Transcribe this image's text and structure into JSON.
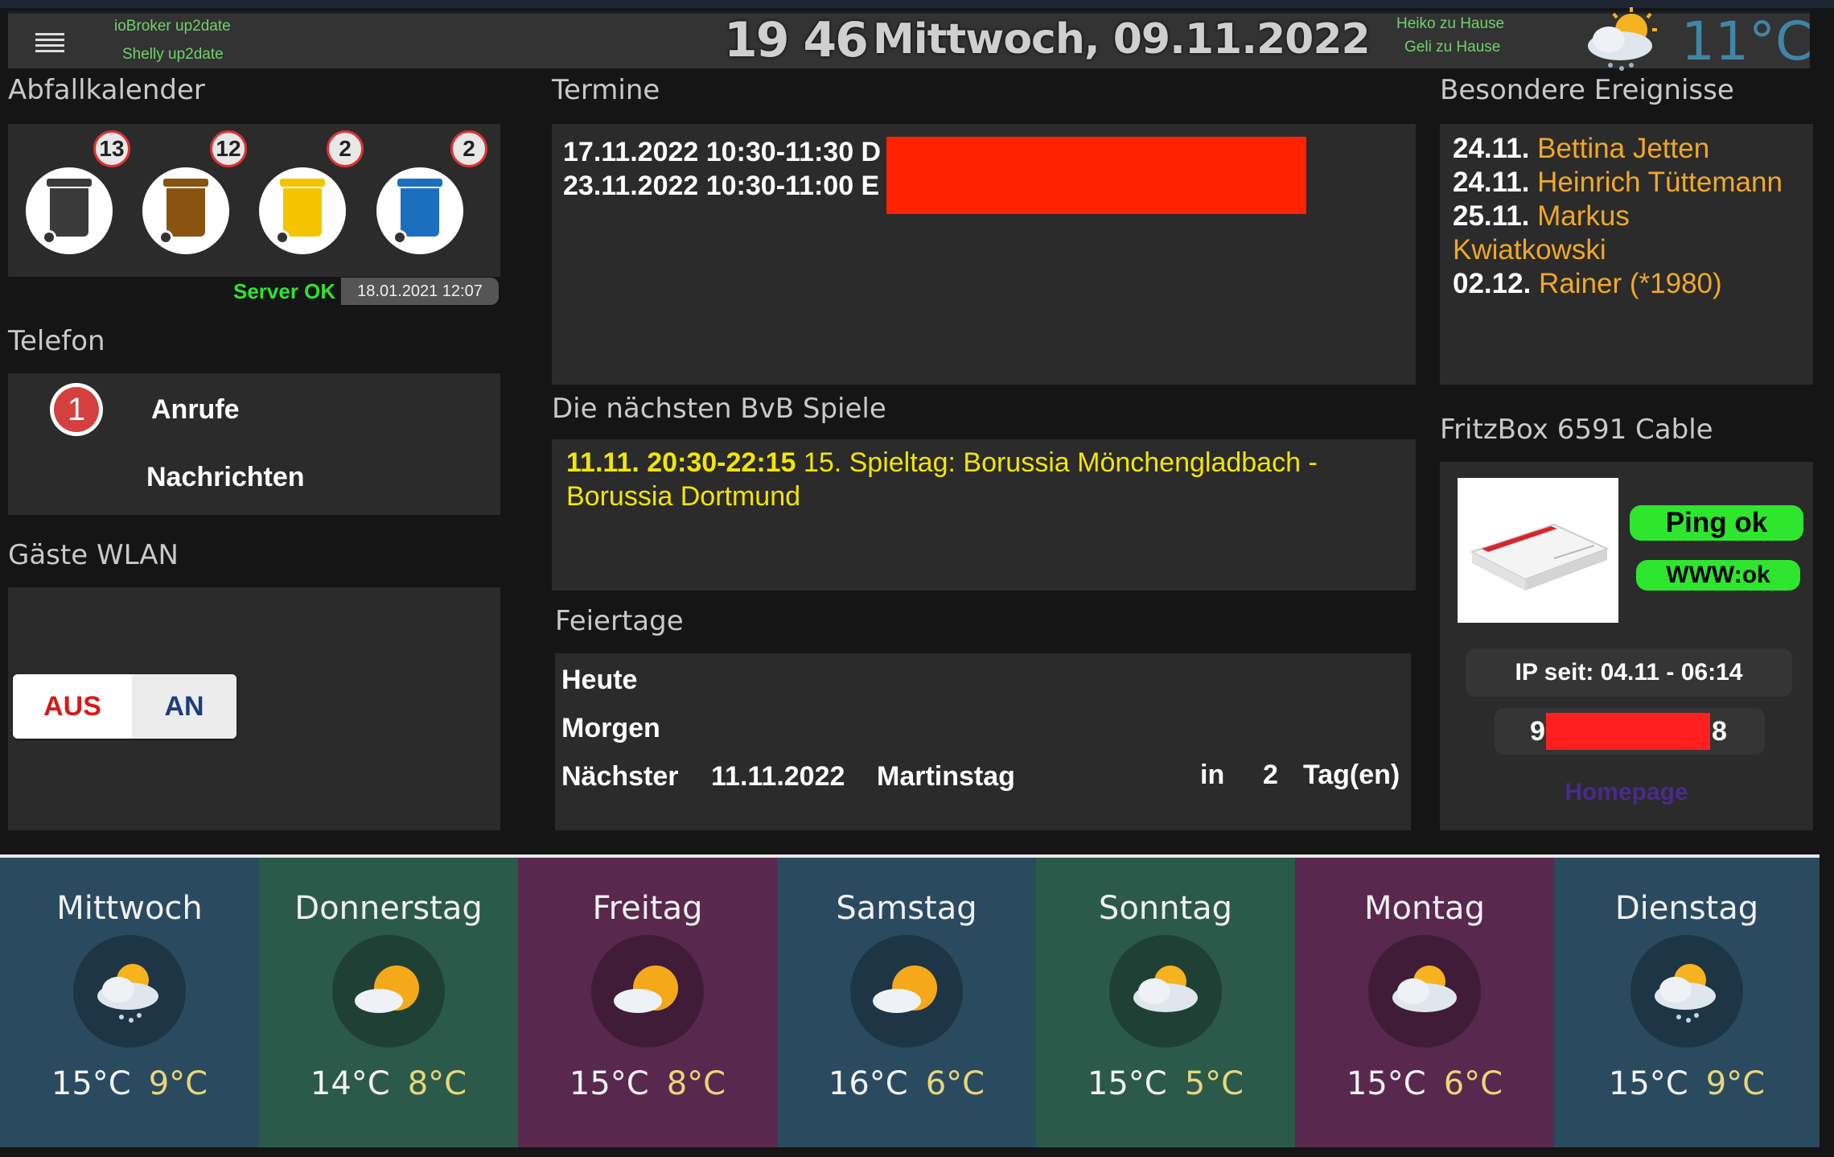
{
  "header": {
    "status_line_1": "ioBroker up2date",
    "status_line_2": "Shelly up2date",
    "time": "19 46",
    "date": "Mittwoch, 09.11.2022",
    "presence_1": "Heiko zu Hause",
    "presence_2": "Geli zu Hause",
    "weather_icon": "cloud-sun-rain-icon",
    "temperature": "11°C"
  },
  "abfall": {
    "title": "Abfallkalender",
    "bins": [
      {
        "color": "#3a3a3a",
        "count": "13"
      },
      {
        "color": "#8a5310",
        "count": "12"
      },
      {
        "color": "#f4c400",
        "count": "2"
      },
      {
        "color": "#1c6fbf",
        "count": "2"
      }
    ],
    "server_status": "Server OK",
    "server_time": "18.01.2021 12:07"
  },
  "telefon": {
    "title": "Telefon",
    "missed_count": "1",
    "calls_label": "Anrufe",
    "messages_label": "Nachrichten"
  },
  "wlan": {
    "title": "Gäste WLAN",
    "off_label": "AUS",
    "on_label": "AN"
  },
  "termine": {
    "title": "Termine",
    "items": [
      "17.11.2022 10:30-11:30 D",
      "23.11.2022 10:30-11:00 E"
    ]
  },
  "bvb": {
    "title": "Die nächsten BvB Spiele",
    "time": "11.11. 20:30-22:15",
    "match": "15. Spieltag: Borussia Mönchengladbach - Borussia Dortmund"
  },
  "feiertage": {
    "title": "Feiertage",
    "today": "Heute",
    "tomorrow": "Morgen",
    "next_label": "Nächster",
    "next_date": "11.11.2022",
    "next_name": "Martinstag",
    "in_label": "in",
    "days": "2",
    "days_unit": "Tag(en)"
  },
  "ereignisse": {
    "title": "Besondere Ereignisse",
    "items": [
      {
        "date": "24.11.",
        "name": "Bettina Jetten"
      },
      {
        "date": "24.11.",
        "name": "Heinrich Tüttemann"
      },
      {
        "date": "25.11.",
        "name": "Markus"
      },
      {
        "date": "",
        "name": "Kwiatkowski"
      },
      {
        "date": "02.12.",
        "name": "Rainer (*1980)"
      }
    ]
  },
  "fritzbox": {
    "title": "FritzBox 6591 Cable",
    "ping": "Ping ok",
    "www": "WWW:ok",
    "ip_since": "IP seit: 04.11 - 06:14",
    "ip_start": "9",
    "ip_end": "8",
    "homepage": "Homepage"
  },
  "forecast": [
    {
      "day": "Mittwoch",
      "max": "15°C",
      "min": "9°C",
      "bg": "#2a4a60",
      "icon": "cloud-sun-rain-icon"
    },
    {
      "day": "Donnerstag",
      "max": "14°C",
      "min": "8°C",
      "bg": "#2b5a4a",
      "icon": "sun-cloud-icon"
    },
    {
      "day": "Freitag",
      "max": "15°C",
      "min": "8°C",
      "bg": "#59284e",
      "icon": "sun-cloud-icon"
    },
    {
      "day": "Samstag",
      "max": "16°C",
      "min": "6°C",
      "bg": "#2a4a60",
      "icon": "sun-cloud-icon"
    },
    {
      "day": "Sonntag",
      "max": "15°C",
      "min": "5°C",
      "bg": "#2b5a4a",
      "icon": "cloud-sun-icon"
    },
    {
      "day": "Montag",
      "max": "15°C",
      "min": "6°C",
      "bg": "#59284e",
      "icon": "cloud-sun-icon"
    },
    {
      "day": "Dienstag",
      "max": "15°C",
      "min": "9°C",
      "bg": "#2a4a60",
      "icon": "cloud-sun-rain-icon"
    }
  ]
}
